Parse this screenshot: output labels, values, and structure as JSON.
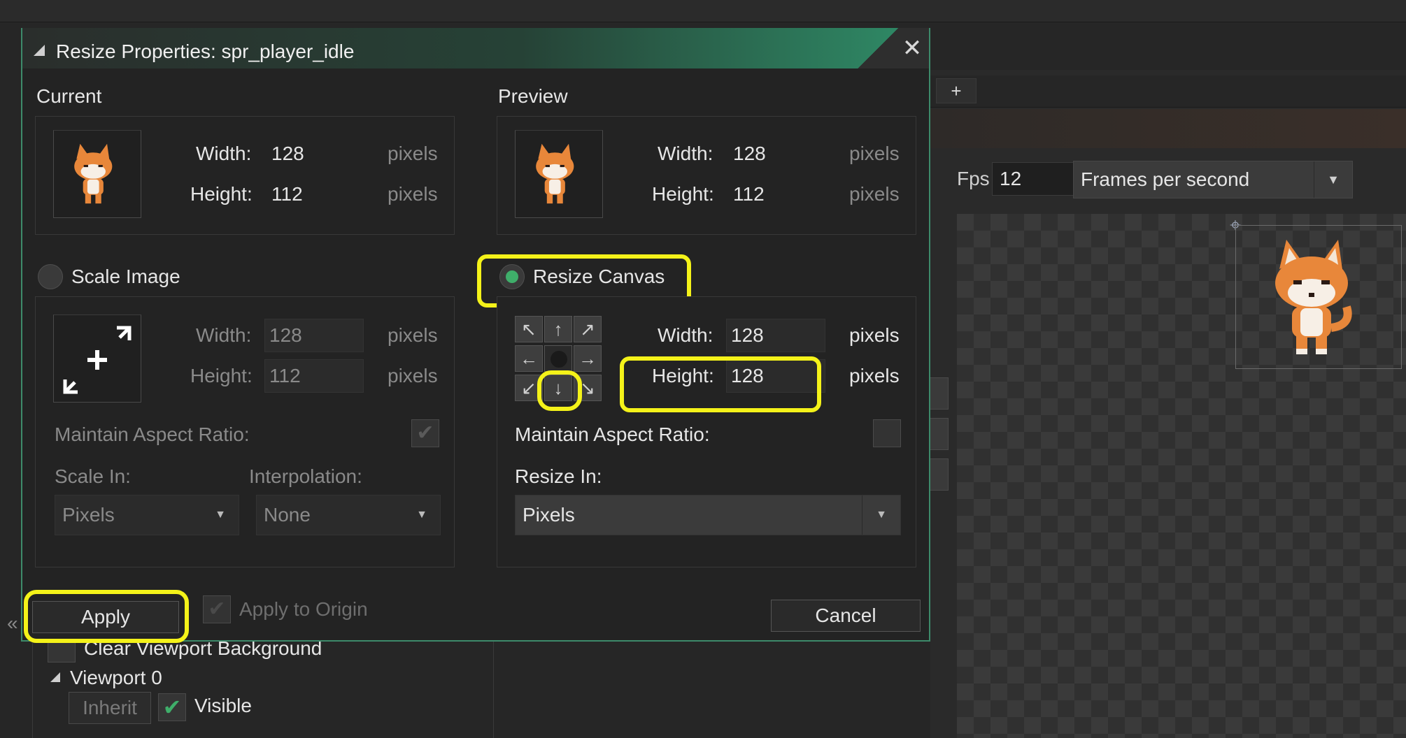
{
  "background": {
    "tab_plus": "+",
    "fps_label": "Fps",
    "fps_value": "12",
    "fps_mode": "Frames per second",
    "clear_viewport": "Clear Viewport Background",
    "viewport_label": "Viewport 0",
    "inherit_label": "Inherit",
    "visible_label": "Visible",
    "collapse_glyph": "«"
  },
  "dialog": {
    "title": "Resize Properties: spr_player_idle",
    "current": {
      "heading": "Current",
      "width_label": "Width:",
      "width_value": "128",
      "height_label": "Height:",
      "height_value": "112",
      "unit": "pixels"
    },
    "preview": {
      "heading": "Preview",
      "width_label": "Width:",
      "width_value": "128",
      "height_label": "Height:",
      "height_value": "112",
      "unit": "pixels"
    },
    "scale_image": {
      "label": "Scale Image",
      "selected": false,
      "width_label": "Width:",
      "width_value": "128",
      "height_label": "Height:",
      "height_value": "112",
      "unit": "pixels",
      "aspect_label": "Maintain Aspect Ratio:",
      "scale_in_label": "Scale In:",
      "scale_in_value": "Pixels",
      "interp_label": "Interpolation:",
      "interp_value": "None"
    },
    "resize_canvas": {
      "label": "Resize Canvas",
      "selected": true,
      "width_label": "Width:",
      "width_value": "128",
      "height_label": "Height:",
      "height_value": "128",
      "unit": "pixels",
      "aspect_label": "Maintain Aspect Ratio:",
      "resize_in_label": "Resize In:",
      "resize_in_value": "Pixels"
    },
    "anchor_grid": [
      "↖",
      "↑",
      "↗",
      "←",
      "",
      "→",
      "↙",
      "↓",
      "↘"
    ],
    "apply_label": "Apply",
    "apply_origin_label": "Apply to Origin",
    "cancel_label": "Cancel"
  },
  "colors": {
    "accent_green": "#3fae6a",
    "highlight_yellow": "#f4f219",
    "title_gradient_end": "#2f8d68"
  }
}
